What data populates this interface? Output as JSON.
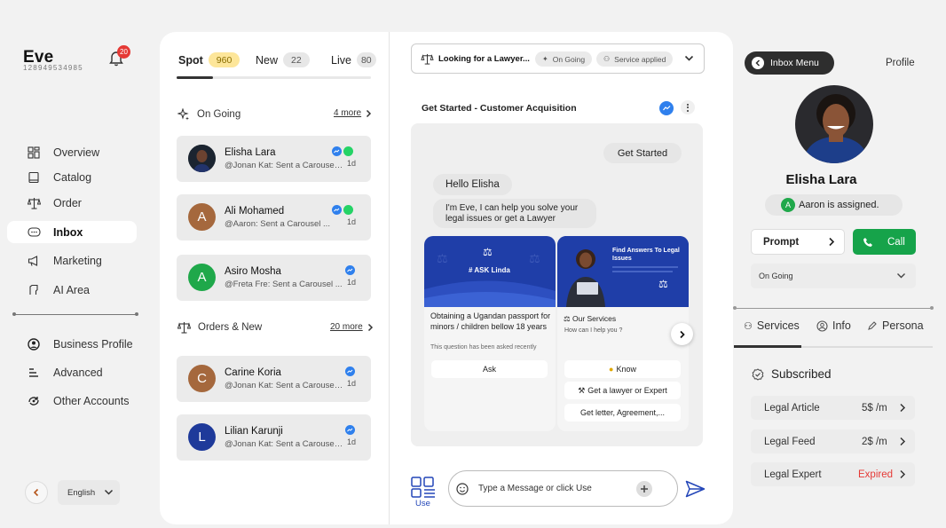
{
  "brand": {
    "name": "Eve",
    "id": "128949534985",
    "notifications": "20"
  },
  "nav": {
    "items": [
      {
        "label": "Overview",
        "icon": "grid-icon"
      },
      {
        "label": "Catalog",
        "icon": "book-icon"
      },
      {
        "label": "Order",
        "icon": "scale-icon"
      },
      {
        "label": "Inbox",
        "icon": "chat-bubble-icon",
        "active": true
      },
      {
        "label": "Marketing",
        "icon": "megaphone-icon"
      },
      {
        "label": "AI Area",
        "icon": "ai-icon"
      }
    ],
    "secondary": [
      {
        "label": "Business Profile",
        "icon": "user-circle-icon"
      },
      {
        "label": "Advanced",
        "icon": "sliders-icon"
      },
      {
        "label": "Other Accounts",
        "icon": "switch-accounts-icon"
      }
    ],
    "language": "English"
  },
  "conversations": {
    "tabs": [
      {
        "label": "Spot",
        "count": "960",
        "active": true
      },
      {
        "label": "New",
        "count": "22"
      },
      {
        "label": "Live",
        "count": "80"
      }
    ],
    "ongoing": {
      "title": "On Going",
      "more": "4 more"
    },
    "orders": {
      "title": "Orders & New",
      "more": "20 more"
    },
    "items": [
      {
        "name": "Elisha Lara",
        "preview": "@Jonan Kat: Sent a Carousel ...",
        "time": "1d",
        "initial": "",
        "color": "#1b2430",
        "channels": [
          "messenger",
          "whatsapp"
        ]
      },
      {
        "name": "Ali Mohamed",
        "preview": "@Aaron: Sent a Carousel ...",
        "time": "1d",
        "initial": "A",
        "color": "#a5683d",
        "channels": [
          "messenger",
          "whatsapp"
        ]
      },
      {
        "name": "Asiro Mosha",
        "preview": "@Freta Fre: Sent a Carousel ...",
        "time": "1d",
        "initial": "A",
        "color": "#1fa84a",
        "channels": [
          "messenger"
        ]
      },
      {
        "name": "Carine Koria",
        "preview": "@Jonan Kat: Sent a Carousel ...",
        "time": "1d",
        "initial": "C",
        "color": "#a5683d",
        "channels": [
          "messenger"
        ]
      },
      {
        "name": "Lilian Karunji",
        "preview": "@Jonan Kat: Sent a Carousel ...",
        "time": "1d",
        "initial": "L",
        "color": "#1e3a9a",
        "channels": [
          "messenger"
        ]
      }
    ]
  },
  "chat": {
    "header_title": "Looking for a Lawyer...",
    "status_pill": "On Going",
    "service_pill": "Service applied",
    "flow_title": "Get Started - Customer Acquisition",
    "messages": {
      "get_started": "Get Started",
      "hello": "Hello Elisha",
      "intro": "I'm Eve, I can help you solve your legal issues or get a Lawyer"
    },
    "card1": {
      "brand": "# ASK Linda",
      "question": "Obtaining a Ugandan passport for minors / children bellow 18 years",
      "note": "This question has been asked recently",
      "button": "Ask"
    },
    "card2": {
      "banner_title": "Find Answers To Legal Issues",
      "title": "Our Services",
      "subtitle": "How can I help you ?",
      "buttons": [
        "Know",
        "Get a lawyer or Expert",
        "Get letter, Agreement,..."
      ]
    },
    "use_label": "Use",
    "input_placeholder": "Type a Message or click Use"
  },
  "profile": {
    "menu_label": "Inbox Menu",
    "title": "Profile",
    "name": "Elisha Lara",
    "assigned_initial": "A",
    "assigned": "Aaron is assigned.",
    "prompt": "Prompt",
    "call": "Call",
    "status": "On Going",
    "tabs": [
      "Services",
      "Info",
      "Persona"
    ],
    "subscribed": "Subscribed",
    "services": [
      {
        "name": "Legal Article",
        "price": "5$ /m",
        "color": "#333333"
      },
      {
        "name": "Legal Feed",
        "price": "2$ /m",
        "color": "#333333"
      },
      {
        "name": "Legal Expert",
        "price": "Expired",
        "color": "#e53935"
      }
    ]
  }
}
